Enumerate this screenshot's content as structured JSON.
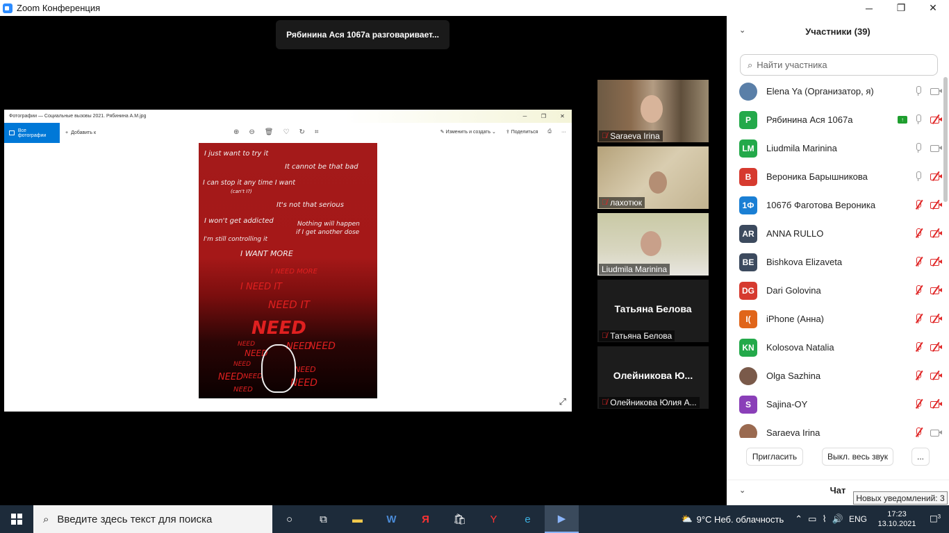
{
  "window": {
    "title": "Zoom Конференция",
    "minimize": "─",
    "maximize": "❐",
    "close": "✕"
  },
  "main": {
    "speaking_banner": "Рябинина Ася 1067а разговаривает..."
  },
  "photos": {
    "title": "Фотографии — Социальные вызовы 2021. Рябинина А.М.jpg",
    "all_photos": "Все фотографии",
    "add_to": "Добавить к",
    "edit_create": "Изменить и создать",
    "share": "Поделиться",
    "more": "···",
    "poster": {
      "lines": [
        "I just want to try it",
        "It cannot be that bad",
        "I can stop it any time I want",
        "(can't I?)",
        "It's not that serious",
        "I won't get addicted",
        "Nothing will happen",
        "if I get another dose",
        "I'm still controlling it",
        "I WANT MORE"
      ],
      "red_lines": [
        "I NEED MORE",
        "I NEED IT",
        "NEED IT",
        "NEED",
        "NEED",
        "NEED",
        "NEED",
        "NEED",
        "NEED",
        "NEED",
        "NEED",
        "NEED",
        "NEED",
        "NEED"
      ]
    }
  },
  "videos": [
    {
      "name": "Saraeva Irina",
      "muted": true
    },
    {
      "name": "лахотюк",
      "muted": true
    },
    {
      "name": "Liudmila Marinina",
      "muted": false
    },
    {
      "name": "Татьяна Белова",
      "bigname": "Татьяна Белова",
      "muted": true
    },
    {
      "name": "Олейникова Юлия А...",
      "bigname": "Олейникова  Ю...",
      "muted": true
    }
  ],
  "participants": {
    "header": "Участники (39)",
    "search_placeholder": "Найти участника",
    "list": [
      {
        "initials": "",
        "name": "Elena Ya (Организатор, я)",
        "color": "#5a7fa8",
        "mic": "on",
        "cam": "on",
        "photo": true
      },
      {
        "initials": "Р",
        "name": "Рябинина Ася 1067а",
        "color": "#23a94a",
        "mic": "on",
        "cam": "off",
        "sharing": true
      },
      {
        "initials": "LM",
        "name": "Liudmila Marinina",
        "color": "#23a94a",
        "mic": "on",
        "cam": "on"
      },
      {
        "initials": "В",
        "name": "Вероника Барышникова",
        "color": "#d63a2f",
        "mic": "on",
        "cam": "off"
      },
      {
        "initials": "1Ф",
        "name": "1067б Фаготова Вероника",
        "color": "#1a7fd4",
        "mic": "off",
        "cam": "off"
      },
      {
        "initials": "AR",
        "name": "ANNA RULLO",
        "color": "#3c4a5e",
        "mic": "off",
        "cam": "off"
      },
      {
        "initials": "BE",
        "name": "Bishkova Elizaveta",
        "color": "#3c4a5e",
        "mic": "off",
        "cam": "off"
      },
      {
        "initials": "DG",
        "name": "Dari Golovina",
        "color": "#d63a2f",
        "mic": "off",
        "cam": "off"
      },
      {
        "initials": "I(",
        "name": "iPhone (Анна)",
        "color": "#e0651a",
        "mic": "off",
        "cam": "off"
      },
      {
        "initials": "KN",
        "name": "Kolosova Natalia",
        "color": "#23a94a",
        "mic": "off",
        "cam": "off"
      },
      {
        "initials": "",
        "name": "Olga Sazhina",
        "color": "#7a5a4a",
        "mic": "off",
        "cam": "off",
        "photo": true
      },
      {
        "initials": "S",
        "name": "Sajina-OY",
        "color": "#8a3fb8",
        "mic": "off",
        "cam": "off"
      },
      {
        "initials": "",
        "name": "Saraeva Irina",
        "color": "#9a6a50",
        "mic": "off",
        "cam": "on",
        "photo": true
      }
    ],
    "invite": "Пригласить",
    "mute_all": "Выкл. весь звук",
    "more": "..."
  },
  "chat": {
    "header": "Чат",
    "notification": "Новых уведомлений: 3"
  },
  "taskbar": {
    "search_placeholder": "Введите здесь текст для поиска",
    "weather": "9°C  Неб. облачность",
    "lang": "ENG",
    "time": "17:23",
    "date": "13.10.2021",
    "notif_count": "3"
  }
}
